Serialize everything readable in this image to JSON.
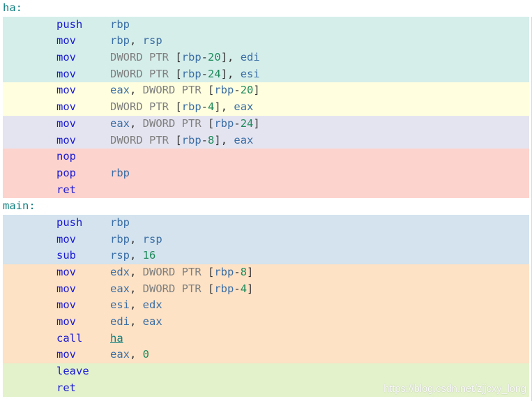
{
  "colors": {
    "label": "#0e7e7e",
    "mnemonic": "#1a1ad4",
    "register": "#3b6ea5",
    "keyword": "#7f7f7f",
    "number": "#1e8a5a",
    "block_teal": "#d5eeea",
    "block_yellow": "#ffffdf",
    "block_lavender": "#e4e4f0",
    "block_red": "#fdd3cd",
    "block_blue": "#d4e3ee",
    "block_orange": "#fde2c5",
    "block_green": "#e3f2cb"
  },
  "functions": [
    {
      "label": "ha:",
      "blocks": [
        {
          "color": "#d5eeea",
          "lines": [
            {
              "op": "push",
              "args": [
                {
                  "t": "reg",
                  "v": "rbp"
                }
              ]
            },
            {
              "op": "mov",
              "args": [
                {
                  "t": "reg",
                  "v": "rbp"
                },
                {
                  "t": "punct",
                  "v": ", "
                },
                {
                  "t": "reg",
                  "v": "rsp"
                }
              ]
            },
            {
              "op": "mov",
              "args": [
                {
                  "t": "kw",
                  "v": "DWORD PTR "
                },
                {
                  "t": "punct",
                  "v": "["
                },
                {
                  "t": "reg",
                  "v": "rbp"
                },
                {
                  "t": "punct",
                  "v": "-"
                },
                {
                  "t": "num",
                  "v": "20"
                },
                {
                  "t": "punct",
                  "v": "], "
                },
                {
                  "t": "reg",
                  "v": "edi"
                }
              ]
            },
            {
              "op": "mov",
              "args": [
                {
                  "t": "kw",
                  "v": "DWORD PTR "
                },
                {
                  "t": "punct",
                  "v": "["
                },
                {
                  "t": "reg",
                  "v": "rbp"
                },
                {
                  "t": "punct",
                  "v": "-"
                },
                {
                  "t": "num",
                  "v": "24"
                },
                {
                  "t": "punct",
                  "v": "], "
                },
                {
                  "t": "reg",
                  "v": "esi"
                }
              ]
            }
          ]
        },
        {
          "color": "#ffffdf",
          "lines": [
            {
              "op": "mov",
              "args": [
                {
                  "t": "reg",
                  "v": "eax"
                },
                {
                  "t": "punct",
                  "v": ", "
                },
                {
                  "t": "kw",
                  "v": "DWORD PTR "
                },
                {
                  "t": "punct",
                  "v": "["
                },
                {
                  "t": "reg",
                  "v": "rbp"
                },
                {
                  "t": "punct",
                  "v": "-"
                },
                {
                  "t": "num",
                  "v": "20"
                },
                {
                  "t": "punct",
                  "v": "]"
                }
              ]
            },
            {
              "op": "mov",
              "args": [
                {
                  "t": "kw",
                  "v": "DWORD PTR "
                },
                {
                  "t": "punct",
                  "v": "["
                },
                {
                  "t": "reg",
                  "v": "rbp"
                },
                {
                  "t": "punct",
                  "v": "-"
                },
                {
                  "t": "num",
                  "v": "4"
                },
                {
                  "t": "punct",
                  "v": "], "
                },
                {
                  "t": "reg",
                  "v": "eax"
                }
              ]
            }
          ]
        },
        {
          "color": "#e4e4f0",
          "lines": [
            {
              "op": "mov",
              "args": [
                {
                  "t": "reg",
                  "v": "eax"
                },
                {
                  "t": "punct",
                  "v": ", "
                },
                {
                  "t": "kw",
                  "v": "DWORD PTR "
                },
                {
                  "t": "punct",
                  "v": "["
                },
                {
                  "t": "reg",
                  "v": "rbp"
                },
                {
                  "t": "punct",
                  "v": "-"
                },
                {
                  "t": "num",
                  "v": "24"
                },
                {
                  "t": "punct",
                  "v": "]"
                }
              ]
            },
            {
              "op": "mov",
              "args": [
                {
                  "t": "kw",
                  "v": "DWORD PTR "
                },
                {
                  "t": "punct",
                  "v": "["
                },
                {
                  "t": "reg",
                  "v": "rbp"
                },
                {
                  "t": "punct",
                  "v": "-"
                },
                {
                  "t": "num",
                  "v": "8"
                },
                {
                  "t": "punct",
                  "v": "], "
                },
                {
                  "t": "reg",
                  "v": "eax"
                }
              ]
            }
          ]
        },
        {
          "color": "#fdd3cd",
          "lines": [
            {
              "op": "nop",
              "args": []
            },
            {
              "op": "pop",
              "args": [
                {
                  "t": "reg",
                  "v": "rbp"
                }
              ]
            },
            {
              "op": "ret",
              "args": []
            }
          ]
        }
      ]
    },
    {
      "label": "main:",
      "blocks": [
        {
          "color": "#d4e3ee",
          "lines": [
            {
              "op": "push",
              "args": [
                {
                  "t": "reg",
                  "v": "rbp"
                }
              ]
            },
            {
              "op": "mov",
              "args": [
                {
                  "t": "reg",
                  "v": "rbp"
                },
                {
                  "t": "punct",
                  "v": ", "
                },
                {
                  "t": "reg",
                  "v": "rsp"
                }
              ]
            },
            {
              "op": "sub",
              "args": [
                {
                  "t": "reg",
                  "v": "rsp"
                },
                {
                  "t": "punct",
                  "v": ", "
                },
                {
                  "t": "num",
                  "v": "16"
                }
              ]
            }
          ]
        },
        {
          "color": "#fde2c5",
          "lines": [
            {
              "op": "mov",
              "args": [
                {
                  "t": "reg",
                  "v": "edx"
                },
                {
                  "t": "punct",
                  "v": ", "
                },
                {
                  "t": "kw",
                  "v": "DWORD PTR "
                },
                {
                  "t": "punct",
                  "v": "["
                },
                {
                  "t": "reg",
                  "v": "rbp"
                },
                {
                  "t": "punct",
                  "v": "-"
                },
                {
                  "t": "num",
                  "v": "8"
                },
                {
                  "t": "punct",
                  "v": "]"
                }
              ]
            },
            {
              "op": "mov",
              "args": [
                {
                  "t": "reg",
                  "v": "eax"
                },
                {
                  "t": "punct",
                  "v": ", "
                },
                {
                  "t": "kw",
                  "v": "DWORD PTR "
                },
                {
                  "t": "punct",
                  "v": "["
                },
                {
                  "t": "reg",
                  "v": "rbp"
                },
                {
                  "t": "punct",
                  "v": "-"
                },
                {
                  "t": "num",
                  "v": "4"
                },
                {
                  "t": "punct",
                  "v": "]"
                }
              ]
            },
            {
              "op": "mov",
              "args": [
                {
                  "t": "reg",
                  "v": "esi"
                },
                {
                  "t": "punct",
                  "v": ", "
                },
                {
                  "t": "reg",
                  "v": "edx"
                }
              ]
            },
            {
              "op": "mov",
              "args": [
                {
                  "t": "reg",
                  "v": "edi"
                },
                {
                  "t": "punct",
                  "v": ", "
                },
                {
                  "t": "reg",
                  "v": "eax"
                }
              ]
            },
            {
              "op": "call",
              "args": [
                {
                  "t": "link",
                  "v": "ha"
                }
              ]
            },
            {
              "op": "mov",
              "args": [
                {
                  "t": "reg",
                  "v": "eax"
                },
                {
                  "t": "punct",
                  "v": ", "
                },
                {
                  "t": "num",
                  "v": "0"
                }
              ]
            }
          ]
        },
        {
          "color": "#e3f2cb",
          "lines": [
            {
              "op": "leave",
              "args": []
            },
            {
              "op": "ret",
              "args": []
            }
          ]
        }
      ]
    }
  ],
  "watermark": "https://blog.csdn.net/zjjcxy_long"
}
